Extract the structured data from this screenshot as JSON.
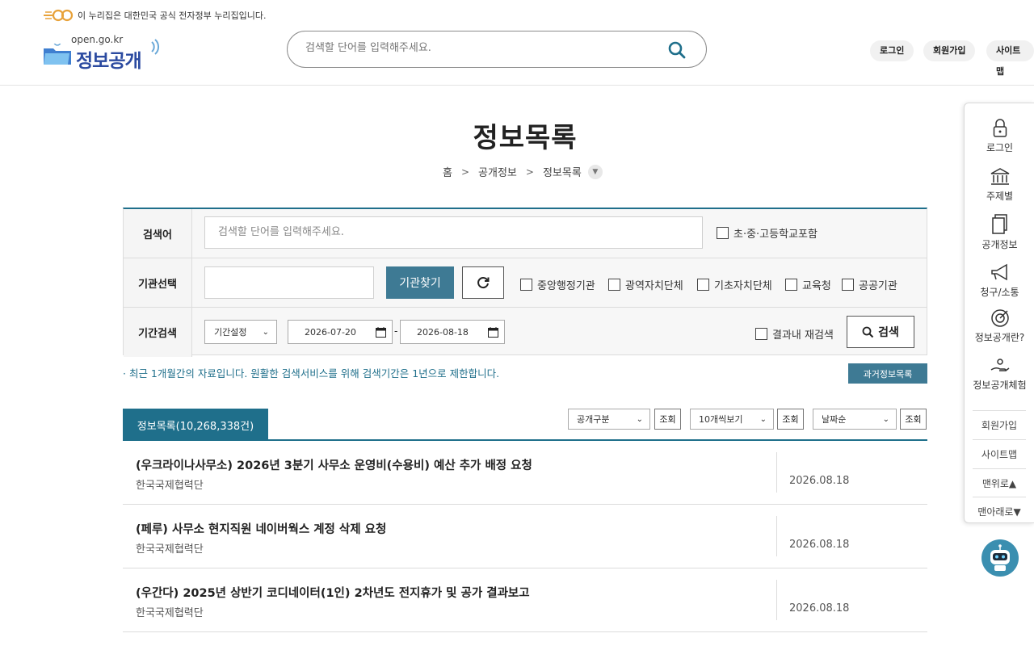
{
  "header": {
    "gov_banner": "이 누리집은 대한민국 공식 전자정부 누리집입니다.",
    "logo_domain": "open.go.kr",
    "logo_text": "정보공개",
    "search_placeholder": "검색할 단어를 입력해주세요.",
    "util_buttons": [
      "로그인",
      "회원가입",
      "사이트맵"
    ]
  },
  "page": {
    "title": "정보목록",
    "breadcrumb": [
      "홈",
      "공개정보",
      "정보목록"
    ]
  },
  "form": {
    "keyword_label": "검색어",
    "keyword_placeholder": "검색할 단어를 입력해주세요.",
    "school_check": "초·중·고등학교포함",
    "agency_label": "기관선택",
    "agency_value": "",
    "agency_find_button": "기관찾기",
    "agency_types": [
      "중앙행정기관",
      "광역자치단체",
      "기초자치단체",
      "교육청",
      "공공기관"
    ],
    "period_label": "기간검색",
    "period_select": "기간설정",
    "date_from": "2026-07-20",
    "date_sep": "-",
    "date_to": "2026-08-18",
    "research_check": "결과내 재검색",
    "search_button": "검색"
  },
  "notice": "· 최근 1개월간의 자료입니다. 원활한 검색서비스를 위해 검색기간은 1년으로 제한합니다.",
  "past_list_button": "과거정보목록",
  "list": {
    "tab_label": "정보목록(10,268,338건)",
    "filter_type": "공개구분",
    "page_size": "10개씩보기",
    "sort": "날짜순",
    "view_button": "조회",
    "items": [
      {
        "title": "(우크라이나사무소) 2026년 3분기 사무소 운영비(수용비) 예산 추가 배정 요청",
        "org": "한국국제협력단",
        "date": "2026.08.18"
      },
      {
        "title": "(페루) 사무소 현지직원 네이버웍스 계정 삭제 요청",
        "org": "한국국제협력단",
        "date": "2026.08.18"
      },
      {
        "title": "(우간다) 2025년 상반기 코디네이터(1인) 2차년도 전지휴가 및 공가 결과보고",
        "org": "한국국제협력단",
        "date": "2026.08.18"
      }
    ]
  },
  "quick_menu": {
    "items": [
      {
        "label": "로그인",
        "icon": "lock-icon"
      },
      {
        "label": "주제별",
        "icon": "building-icon"
      },
      {
        "label": "공개정보",
        "icon": "document-icon"
      },
      {
        "label": "청구/소통",
        "icon": "megaphone-icon"
      },
      {
        "label": "정보공개란?",
        "icon": "target-icon"
      },
      {
        "label": "정보공개체험",
        "icon": "hand-icon"
      }
    ],
    "links": [
      "회원가입",
      "사이트맵",
      "맨위로▲",
      "맨아래로▼"
    ]
  },
  "colors": {
    "accent": "#1f6f8b",
    "button": "#3e7a94",
    "logo_blue": "#2b4aa0"
  }
}
